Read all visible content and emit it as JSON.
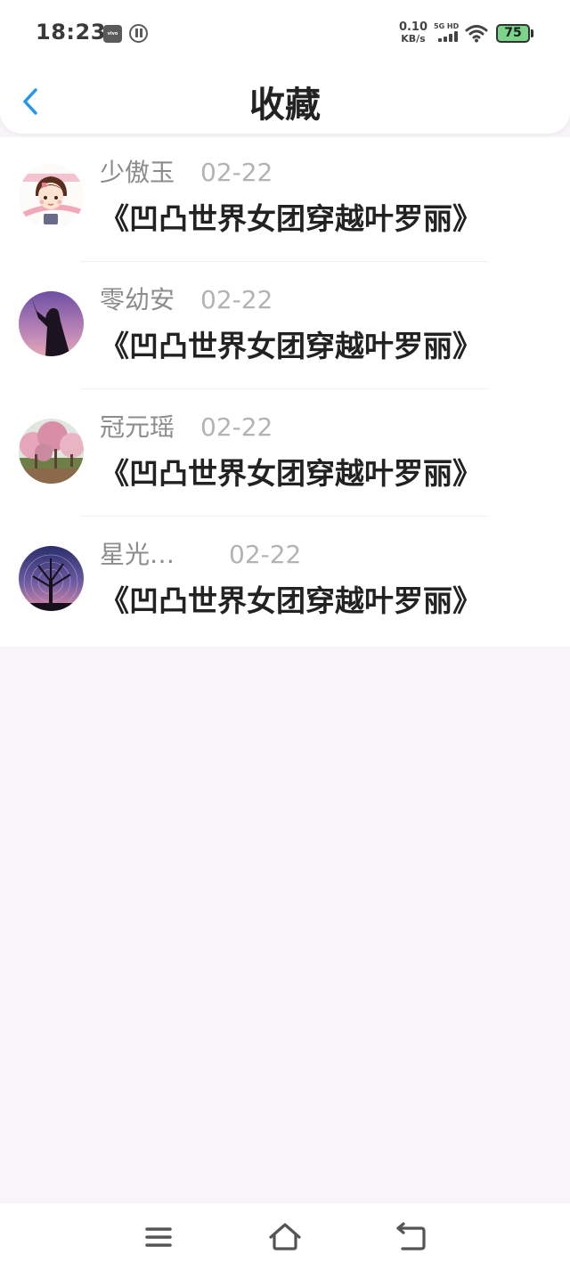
{
  "status_bar": {
    "time": "18:23",
    "vivo_label": "vivo",
    "net_speed_value": "0.10",
    "net_speed_unit": "KB/s",
    "signal_label": "5G HD",
    "battery_level": "75",
    "battery_color": "#7ad58b"
  },
  "header": {
    "title": "收藏",
    "back_icon": "chevron-left-icon",
    "accent_color": "#2196f3"
  },
  "favorites": [
    {
      "user": "少傲玉",
      "date": "02-22",
      "title": "《凹凸世界女团穿越叶罗丽》",
      "avatar": "cartoon-girl"
    },
    {
      "user": "零幼安",
      "date": "02-22",
      "title": "《凹凸世界女团穿越叶罗丽》",
      "avatar": "silhouette-purple-sky"
    },
    {
      "user": "冠元瑶",
      "date": "02-22",
      "title": "《凹凸世界女团穿越叶罗丽》",
      "avatar": "blossom-trees"
    },
    {
      "user": "星光…",
      "date": "02-22",
      "title": "《凹凸世界女团穿越叶罗丽》",
      "avatar": "starry-tree"
    }
  ],
  "nav_bar": {
    "menu_icon": "menu-icon",
    "home_icon": "home-icon",
    "back_icon": "back-icon"
  }
}
